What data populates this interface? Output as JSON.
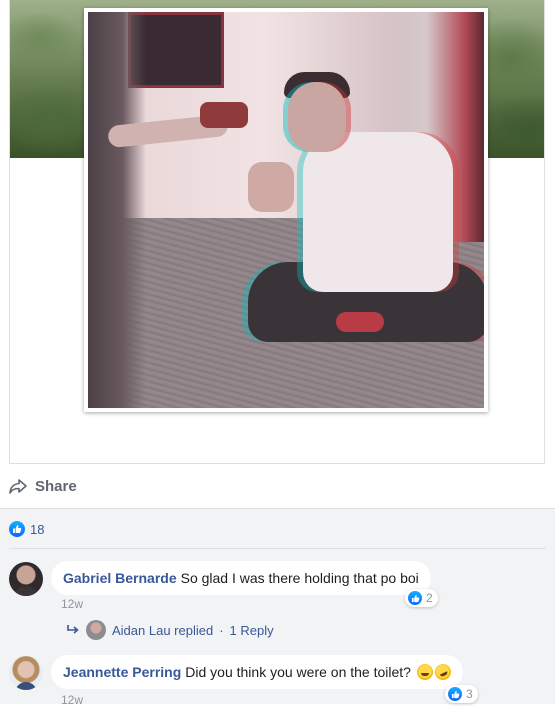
{
  "post": {
    "share_label": "Share",
    "reactions_count": "18"
  },
  "comments": [
    {
      "author": "Gabriel Bernarde",
      "text": "So glad I was there holding that po boi",
      "time": "12w",
      "likes": "2",
      "reply": {
        "author_text": "Aidan Lau replied",
        "separator": "·",
        "count_text": "1 Reply"
      }
    },
    {
      "author": "Jeannette Perring",
      "text": "Did you think you were on the toilet?",
      "emoji": [
        "laughing-tears-emoji",
        "rolling-laughing-emoji"
      ],
      "time": "12w",
      "likes": "3"
    }
  ],
  "colors": {
    "link_blue": "#385898",
    "like_blue": "#0866ff",
    "muted_text": "#90949c",
    "comments_bg": "#f2f3f5"
  }
}
